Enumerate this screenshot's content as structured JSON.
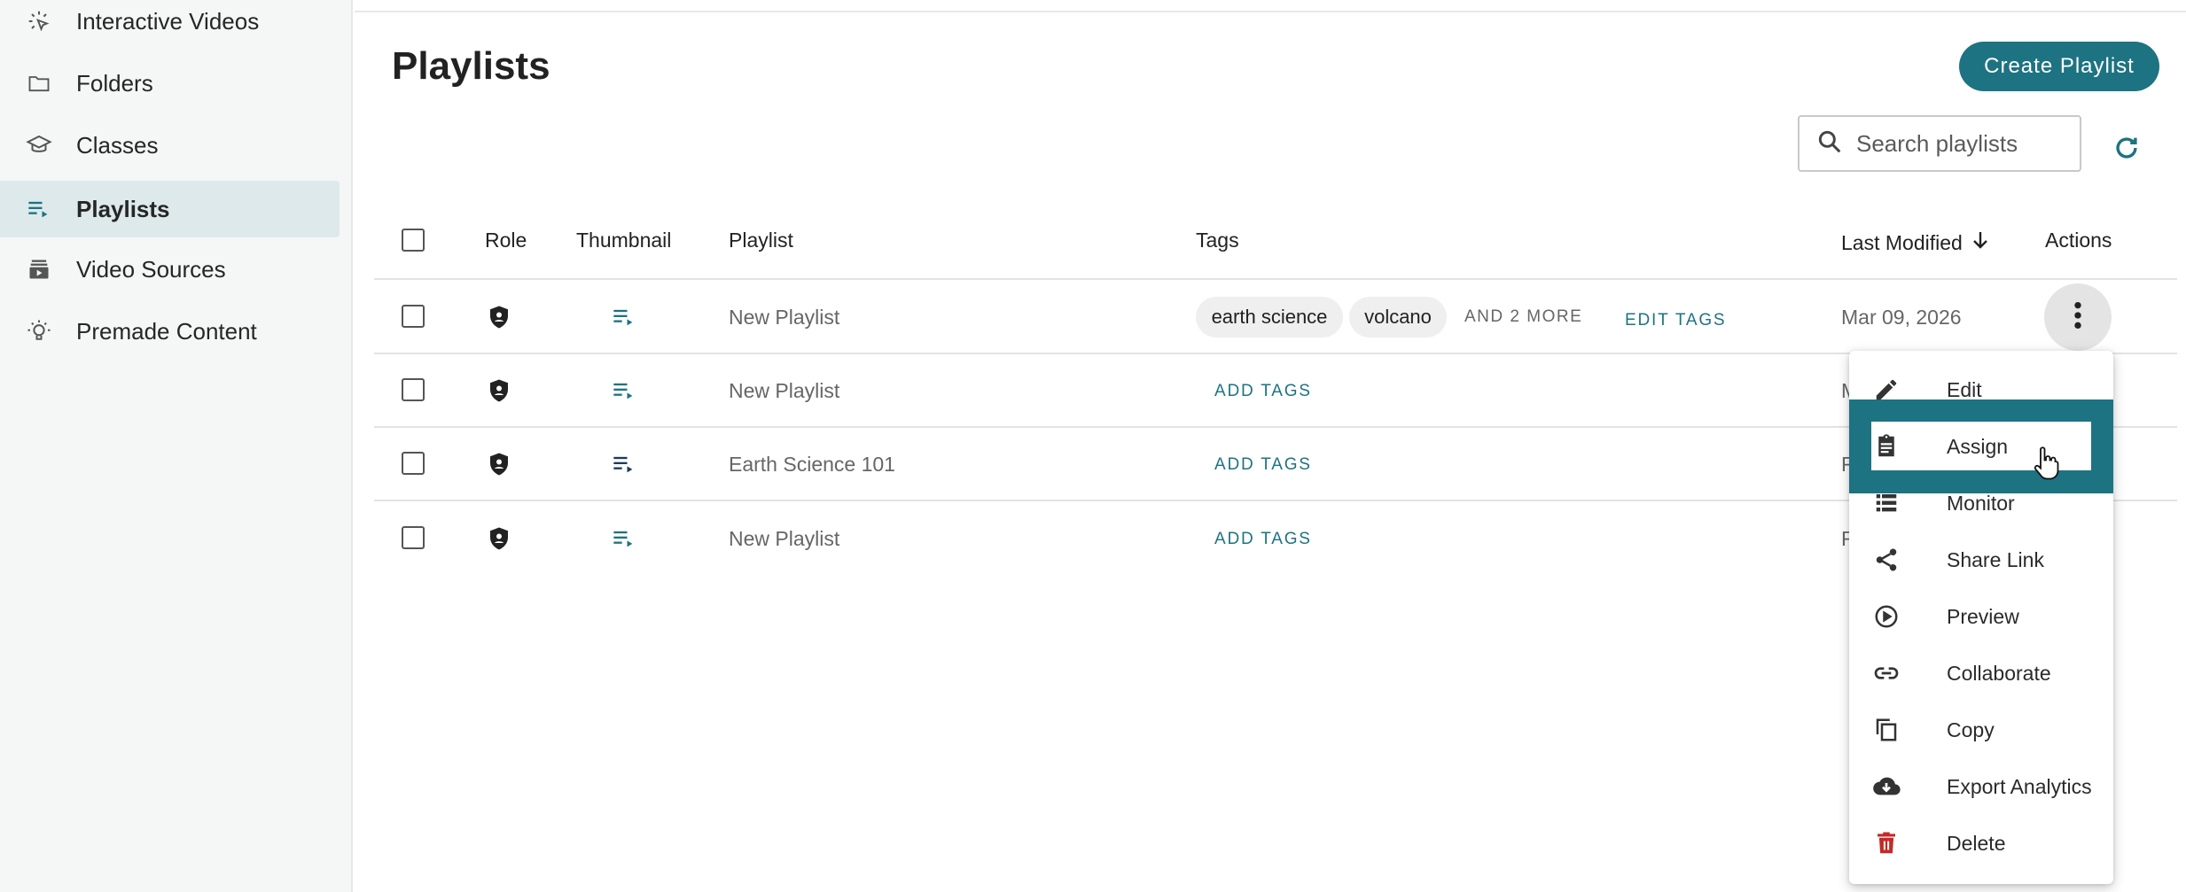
{
  "sidebar": {
    "items": [
      {
        "label": "Interactive Videos",
        "icon": "cursor-click-icon"
      },
      {
        "label": "Folders",
        "icon": "folder-icon"
      },
      {
        "label": "Classes",
        "icon": "graduation-cap-icon"
      },
      {
        "label": "Playlists",
        "icon": "playlist-icon",
        "active": true
      },
      {
        "label": "Video Sources",
        "icon": "video-library-icon"
      },
      {
        "label": "Premade Content",
        "icon": "lightbulb-icon"
      }
    ]
  },
  "page": {
    "title": "Playlists",
    "create_label": "Create Playlist",
    "search_placeholder": "Search playlists"
  },
  "table": {
    "headers": {
      "role": "Role",
      "thumbnail": "Thumbnail",
      "playlist": "Playlist",
      "tags": "Tags",
      "last_modified": "Last Modified",
      "actions": "Actions"
    },
    "rows": [
      {
        "name": "New Playlist",
        "tags": [
          "earth science",
          "volcano"
        ],
        "more": "AND 2 MORE",
        "tag_action": "EDIT TAGS",
        "date": "Mar 09, 2026"
      },
      {
        "name": "New Playlist",
        "tags": [],
        "tag_action": "ADD TAGS",
        "date_partial": "M"
      },
      {
        "name": "Earth Science 101",
        "tags": [],
        "tag_action": "ADD TAGS",
        "date_partial": "F"
      },
      {
        "name": "New Playlist",
        "tags": [],
        "tag_action": "ADD TAGS",
        "date_partial": "F"
      }
    ]
  },
  "menu": {
    "items": [
      {
        "label": "Edit",
        "icon": "pencil-icon"
      },
      {
        "label": "Assign",
        "icon": "clipboard-icon",
        "highlighted": true
      },
      {
        "label": "Monitor",
        "icon": "list-icon"
      },
      {
        "label": "Share Link",
        "icon": "share-icon"
      },
      {
        "label": "Preview",
        "icon": "play-circle-icon"
      },
      {
        "label": "Collaborate",
        "icon": "link-icon"
      },
      {
        "label": "Copy",
        "icon": "copy-icon"
      },
      {
        "label": "Export Analytics",
        "icon": "cloud-download-icon"
      },
      {
        "label": "Delete",
        "icon": "trash-icon"
      }
    ]
  },
  "colors": {
    "accent": "#1d7382",
    "active_nav": "#dde9eb",
    "delete": "#c62828"
  }
}
